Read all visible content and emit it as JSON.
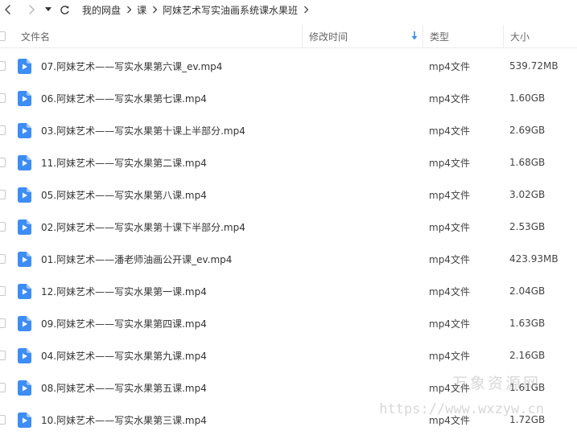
{
  "breadcrumb": [
    "我的网盘",
    "课",
    "阿妹艺术写实油画系统课水果班"
  ],
  "columns": {
    "name": "文件名",
    "mtime": "修改时间",
    "type": "类型",
    "size": "大小"
  },
  "files": [
    {
      "name": "07.阿妹艺术——写实水果第六课_ev.mp4",
      "type": "mp4文件",
      "size": "539.72MB"
    },
    {
      "name": "06.阿妹艺术——写实水果第七课.mp4",
      "type": "mp4文件",
      "size": "1.60GB"
    },
    {
      "name": "03.阿妹艺术——写实水果第十课上半部分.mp4",
      "type": "mp4文件",
      "size": "2.69GB"
    },
    {
      "name": "11.阿妹艺术——写实水果第二课.mp4",
      "type": "mp4文件",
      "size": "1.68GB"
    },
    {
      "name": "05.阿妹艺术——写实水果第八课.mp4",
      "type": "mp4文件",
      "size": "3.02GB"
    },
    {
      "name": "02.阿妹艺术——写实水果第十课下半部分.mp4",
      "type": "mp4文件",
      "size": "2.53GB"
    },
    {
      "name": "01.阿妹艺术——潘老师油画公开课_ev.mp4",
      "type": "mp4文件",
      "size": "423.93MB"
    },
    {
      "name": "12.阿妹艺术——写实水果第一课.mp4",
      "type": "mp4文件",
      "size": "2.04GB"
    },
    {
      "name": "09.阿妹艺术——写实水果第四课.mp4",
      "type": "mp4文件",
      "size": "1.63GB"
    },
    {
      "name": "04.阿妹艺术——写实水果第九课.mp4",
      "type": "mp4文件",
      "size": "2.16GB"
    },
    {
      "name": "08.阿妹艺术——写实水果第五课.mp4",
      "type": "mp4文件",
      "size": "1.61GB"
    },
    {
      "name": "10.阿妹艺术——写实水果第三课.mp4",
      "type": "mp4文件",
      "size": "1.72GB"
    }
  ],
  "watermark": {
    "line1": "万象资源网",
    "line2": "https://www.wxzyw.cn"
  },
  "icons": {
    "back": "chevron-left-icon",
    "forward": "chevron-right-icon",
    "history": "caret-down-icon",
    "refresh": "refresh-icon",
    "sort": "sort-down-arrow-icon",
    "file": "video-file-icon"
  },
  "colors": {
    "file_icon": "#3d8df5",
    "sort_arrow": "#3a8ee6"
  }
}
